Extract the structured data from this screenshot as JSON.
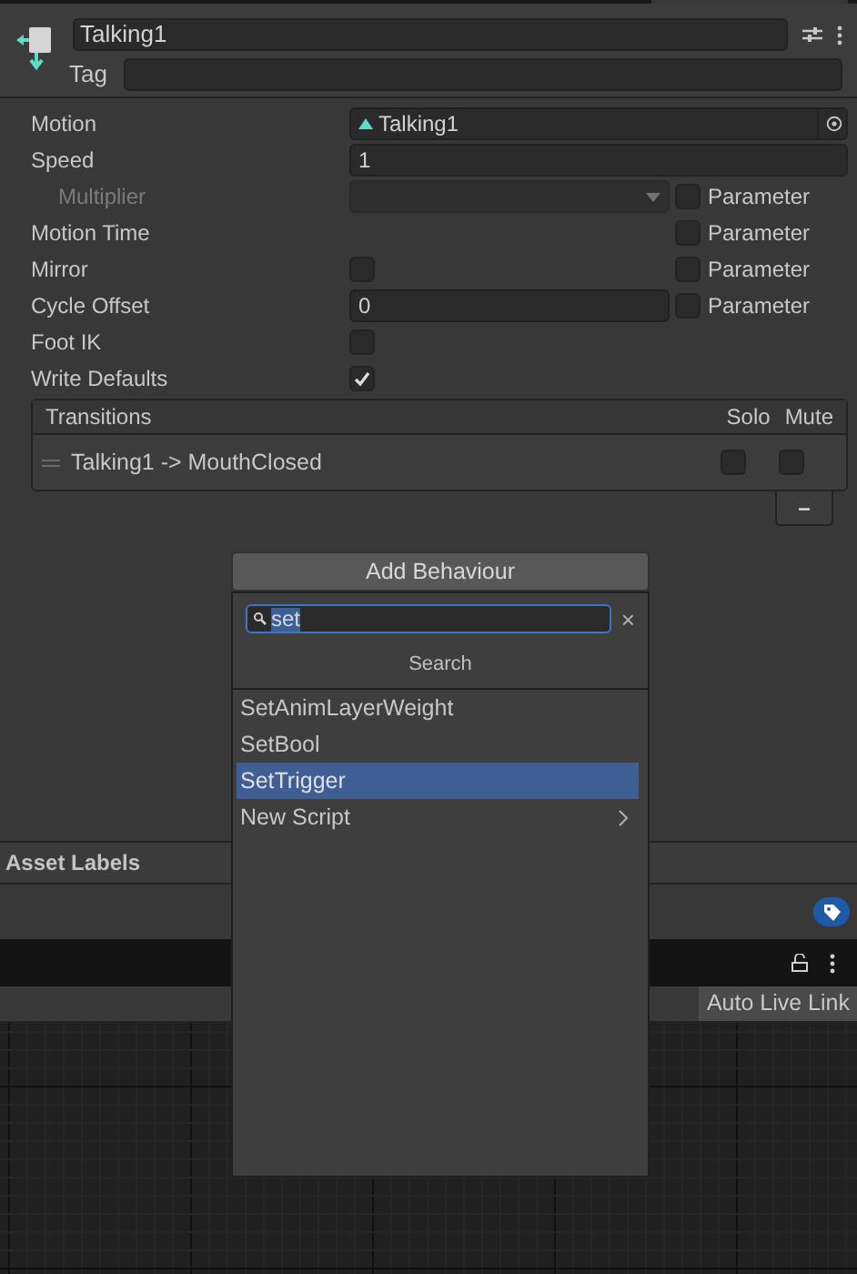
{
  "header": {
    "name": "Talking1",
    "tag_label": "Tag"
  },
  "properties": [
    {
      "label": "Motion",
      "kind": "object",
      "value": "Talking1",
      "disabled": false
    },
    {
      "label": "Speed",
      "kind": "text",
      "value": "1",
      "disabled": false
    },
    {
      "label": "Multiplier",
      "kind": "dropdown",
      "disabled": true,
      "parameter": {
        "label": "Parameter",
        "checked": false
      }
    },
    {
      "label": "Motion Time",
      "kind": "none",
      "disabled": false,
      "parameter": {
        "label": "Parameter",
        "checked": false
      }
    },
    {
      "label": "Mirror",
      "kind": "checkbox",
      "checked": false,
      "disabled": false,
      "parameter": {
        "label": "Parameter",
        "checked": false
      }
    },
    {
      "label": "Cycle Offset",
      "kind": "text",
      "value": "0",
      "disabled": false,
      "parameter": {
        "label": "Parameter",
        "checked": false
      }
    },
    {
      "label": "Foot IK",
      "kind": "checkbox",
      "checked": false,
      "disabled": false
    },
    {
      "label": "Write Defaults",
      "kind": "checkbox",
      "checked": true,
      "disabled": false
    }
  ],
  "transitions": {
    "title": "Transitions",
    "solo_label": "Solo",
    "mute_label": "Mute",
    "rows": [
      {
        "label": "Talking1 -> MouthClosed",
        "solo": false,
        "mute": false
      }
    ],
    "remove_label": "–"
  },
  "popup": {
    "button": "Add Behaviour",
    "search_value": "set",
    "clear": "×",
    "section": "Search",
    "items": [
      {
        "label": "SetAnimLayerWeight",
        "selected": false,
        "submenu": false
      },
      {
        "label": "SetBool",
        "selected": false,
        "submenu": false
      },
      {
        "label": "SetTrigger",
        "selected": true,
        "submenu": false
      },
      {
        "label": "New Script",
        "selected": false,
        "submenu": true
      }
    ]
  },
  "asset_labels": {
    "title": "Asset Labels"
  },
  "animator": {
    "toolbar_button": "Auto Live Link"
  }
}
